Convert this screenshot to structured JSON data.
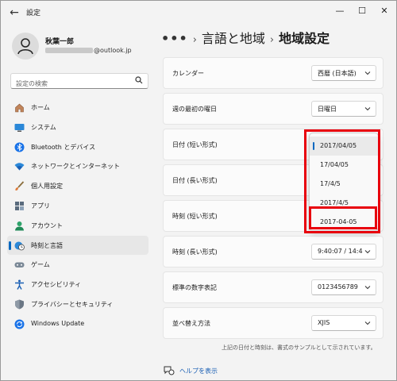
{
  "window": {
    "title": "設定",
    "controls": {
      "minimize": "—",
      "maximize": "☐",
      "close": "✕"
    }
  },
  "user": {
    "name": "秋葉一郎",
    "email": "@outlook.jp"
  },
  "search": {
    "placeholder": "設定の検索"
  },
  "sidebar": {
    "items": [
      {
        "label": "ホーム",
        "icon": "home-icon"
      },
      {
        "label": "システム",
        "icon": "monitor-icon"
      },
      {
        "label": "Bluetooth とデバイス",
        "icon": "bluetooth-icon"
      },
      {
        "label": "ネットワークとインターネット",
        "icon": "wifi-icon"
      },
      {
        "label": "個人用設定",
        "icon": "brush-icon"
      },
      {
        "label": "アプリ",
        "icon": "apps-icon"
      },
      {
        "label": "アカウント",
        "icon": "account-icon"
      },
      {
        "label": "時刻と言語",
        "icon": "clock-globe-icon"
      },
      {
        "label": "ゲーム",
        "icon": "gamepad-icon"
      },
      {
        "label": "アクセシビリティ",
        "icon": "accessibility-icon"
      },
      {
        "label": "プライバシーとセキュリティ",
        "icon": "shield-icon"
      },
      {
        "label": "Windows Update",
        "icon": "update-icon"
      }
    ],
    "active_index": 7
  },
  "breadcrumb": {
    "more": "•••",
    "separator": "›",
    "parent": "言語と地域",
    "current": "地域設定"
  },
  "settings": [
    {
      "label": "カレンダー",
      "value": "西暦 (日本語)",
      "has_dropdown": true
    },
    {
      "label": "週の最初の曜日",
      "value": "日曜日",
      "has_dropdown": true
    },
    {
      "label": "日付 (短い形式)",
      "value": "",
      "has_dropdown": false
    },
    {
      "label": "日付 (長い形式)",
      "value": "",
      "has_dropdown": false
    },
    {
      "label": "時刻 (短い形式)",
      "value": "",
      "has_dropdown": false
    },
    {
      "label": "時刻 (長い形式)",
      "value": "9:40:07 / 14:4",
      "has_dropdown": true
    },
    {
      "label": "標準の数字表記",
      "value": "0123456789",
      "has_dropdown": true
    },
    {
      "label": "並べ替え方法",
      "value": "XJIS",
      "has_dropdown": true
    }
  ],
  "dropdown_popup": {
    "options": [
      "2017/04/05",
      "17/04/05",
      "17/4/5",
      "2017/4/5",
      "2017-04-05"
    ],
    "selected_index": 0
  },
  "footnote": "上記の日付と時刻は、書式のサンプルとして示されています。",
  "help_link": {
    "label": "ヘルプを表示"
  },
  "colors": {
    "accent": "#0067c0",
    "highlight": "#e8000d",
    "background": "#f3f3f3",
    "card": "#fbfbfb"
  }
}
